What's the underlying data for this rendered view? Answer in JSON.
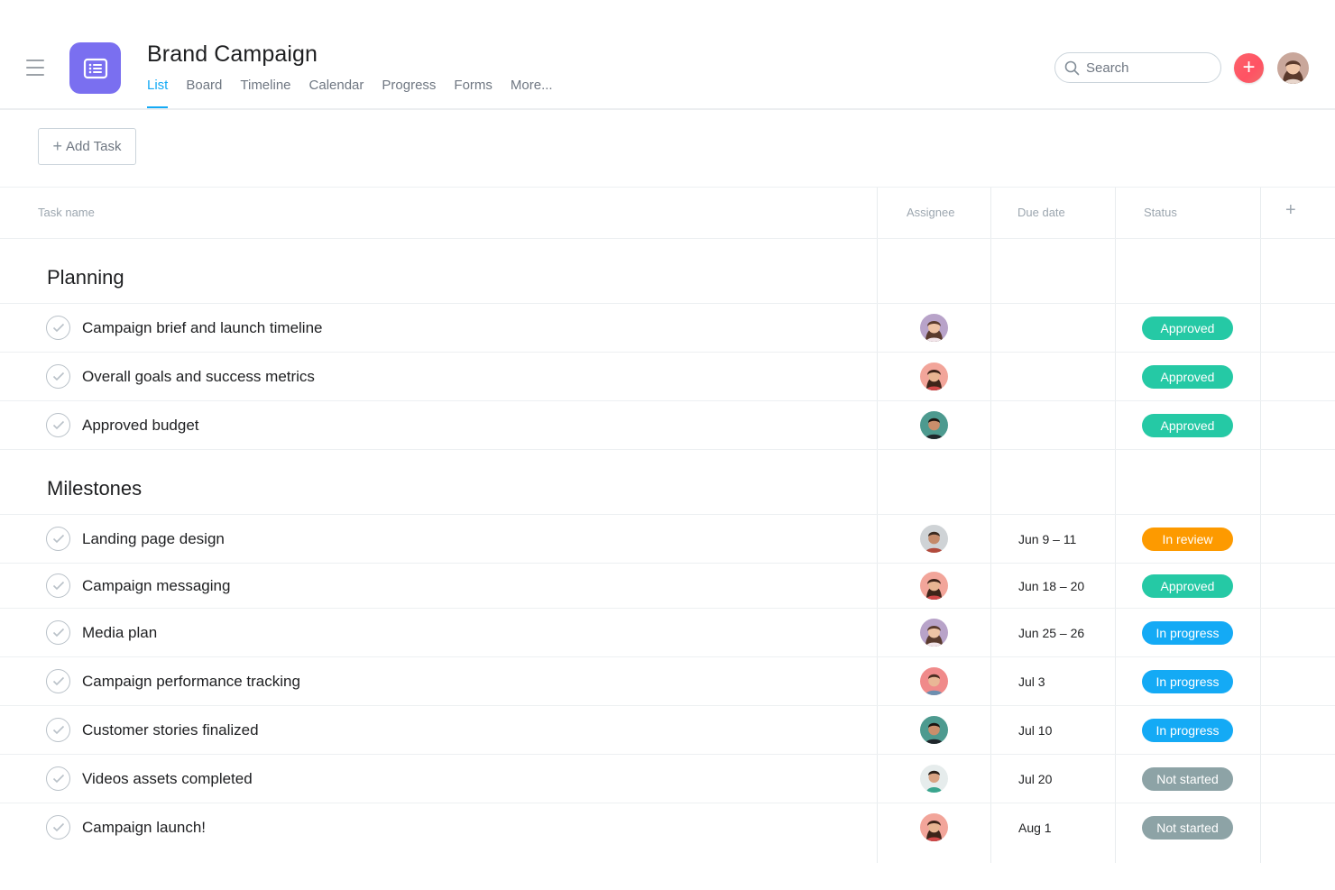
{
  "header": {
    "project_title": "Brand Campaign",
    "project_icon": "list-icon",
    "tabs": [
      {
        "label": "List",
        "active": true
      },
      {
        "label": "Board",
        "active": false
      },
      {
        "label": "Timeline",
        "active": false
      },
      {
        "label": "Calendar",
        "active": false
      },
      {
        "label": "Progress",
        "active": false
      },
      {
        "label": "Forms",
        "active": false
      },
      {
        "label": "More...",
        "active": false
      }
    ],
    "search": {
      "placeholder": "Search"
    },
    "quick_add_label": "+"
  },
  "toolbar": {
    "add_task_label": "Add Task"
  },
  "table": {
    "columns": {
      "task_name": "Task name",
      "assignee": "Assignee",
      "due_date": "Due date",
      "status": "Status",
      "add_column": "+"
    },
    "sections": [
      {
        "title": "Planning",
        "tasks": [
          {
            "name": "Campaign brief and launch timeline",
            "due": "",
            "status": "Approved"
          },
          {
            "name": "Overall goals and success metrics",
            "due": "",
            "status": "Approved"
          },
          {
            "name": "Approved budget",
            "due": "",
            "status": "Approved"
          }
        ]
      },
      {
        "title": "Milestones",
        "tasks": [
          {
            "name": "Landing page design",
            "due": "Jun 9 – 11",
            "status": "In review"
          },
          {
            "name": "Campaign messaging",
            "due": "Jun 18 – 20",
            "status": "Approved"
          },
          {
            "name": "Media plan",
            "due": "Jun 25 – 26",
            "status": "In progress"
          },
          {
            "name": "Campaign performance tracking",
            "due": "Jul 3",
            "status": "In progress"
          },
          {
            "name": "Customer stories finalized",
            "due": "Jul 10",
            "status": "In progress"
          },
          {
            "name": "Videos assets completed",
            "due": "Jul 20",
            "status": "Not started"
          },
          {
            "name": "Campaign launch!",
            "due": "Aug 1",
            "status": "Not started"
          }
        ]
      }
    ]
  },
  "colors": {
    "accent": "#14aaf5",
    "project_icon_bg": "#7a6ff0",
    "quick_add": "#fc636b",
    "status_approved": "#25c9a5",
    "status_in_review": "#fd9a00",
    "status_in_progress": "#14aaf5",
    "status_not_started": "#8da3a6"
  }
}
